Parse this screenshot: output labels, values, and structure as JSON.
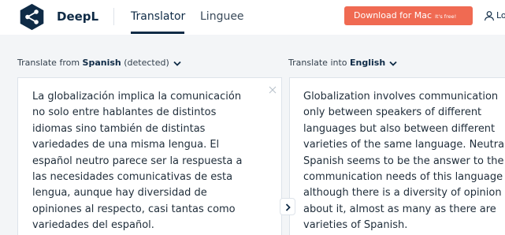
{
  "header": {
    "brand": "DeepL",
    "nav_translator": "Translator",
    "nav_linguee": "Linguee",
    "download_label": "Download for Mac",
    "download_badge": "It's free!",
    "login_text": "Lo",
    "download_color": "#f06a52",
    "brand_color": "#0f2b46"
  },
  "source": {
    "prefix": "Translate from ",
    "language": "Spanish",
    "suffix": " (detected)",
    "text": "La globalización implica la comunicación\nno solo entre hablantes de distintos\nidiomas sino también de distintas\nvariedades de una misma lengua. El\nespañol neutro parece ser la respuesta a\nlas necesidades comunicativas de esta\nlengua, aunque hay diversidad de\nopiniones al respecto, casi tantas como\nvariedades del español."
  },
  "target": {
    "prefix": "Translate into ",
    "language": "English",
    "text": "Globalization involves communication\nonly between speakers of different\nlanguages but also between different\nvarieties of the same language. Neutral\nSpanish seems to be the answer to the\ncommunication needs of this language\nalthough there is a diversity of opinion\nabout it, almost as many as there are\nvarieties of Spanish."
  },
  "icons": {
    "logo": "deepl-logo",
    "user": "user-icon",
    "clear": "close-icon",
    "swap": "chevron-right-icon",
    "dropdown": "chevron-down-icon"
  }
}
